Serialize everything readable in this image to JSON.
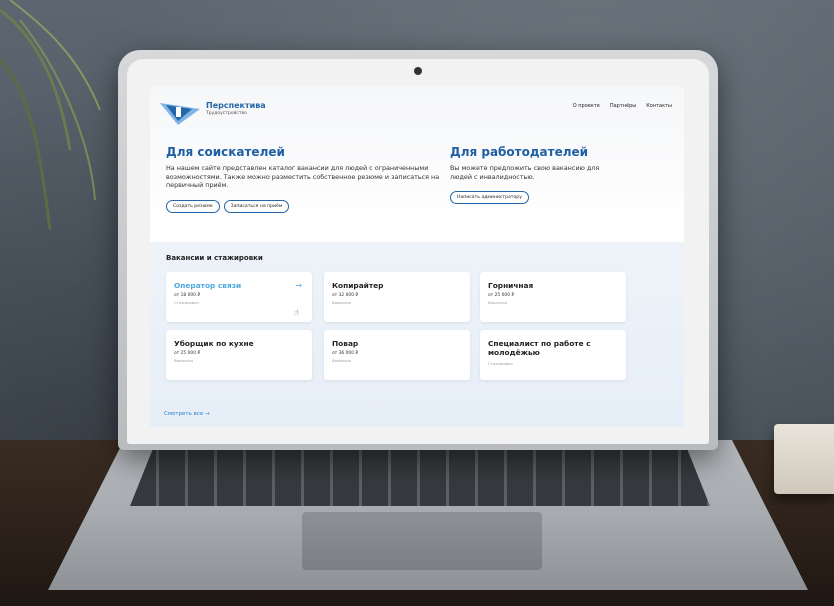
{
  "header": {
    "brand_name": "Перспектива",
    "brand_sub": "Трудоустройство",
    "nav": [
      "О проекте",
      "Партнёры",
      "Контакты"
    ]
  },
  "seekers": {
    "title": "Для соискателей",
    "text": "На нашем сайте представлен каталог вакансии для людей с ограниченными возможностями. Также можно разместить собственное резюме и записаться на первичный приём.",
    "btn_resume": "Создать резюме",
    "btn_signup": "Записаться на приём"
  },
  "employers": {
    "title": "Для работодателей",
    "text": "Вы можете предложить свою вакансию для людей с инвалидностью.",
    "btn_write": "Написать администратору"
  },
  "vacancies": {
    "title": "Вакансии и стажировки",
    "cards": [
      {
        "title": "Оператор связи",
        "salary": "от 18 000 ₽",
        "kind": "Стажировка"
      },
      {
        "title": "Копирайтер",
        "salary": "от 32 000 ₽",
        "kind": "Вакансия"
      },
      {
        "title": "Горничная",
        "salary": "от 25 000 ₽",
        "kind": "Вакансия"
      },
      {
        "title": "Уборщик по кухне",
        "salary": "от 25 000 ₽",
        "kind": "Вакансия"
      },
      {
        "title": "Повар",
        "salary": "от 36 000 ₽",
        "kind": "Вакансия"
      },
      {
        "title": "Специалист по работе с молодёжью",
        "salary": "",
        "kind": "Стажировка"
      }
    ],
    "arrow": "→",
    "see_all": "Смотреть все →"
  },
  "icons": {
    "logo": "perspektiva-logo",
    "cursor": "hand-cursor-icon"
  },
  "colors": {
    "accent": "#1f5fa3",
    "link": "#4ea8e0"
  }
}
